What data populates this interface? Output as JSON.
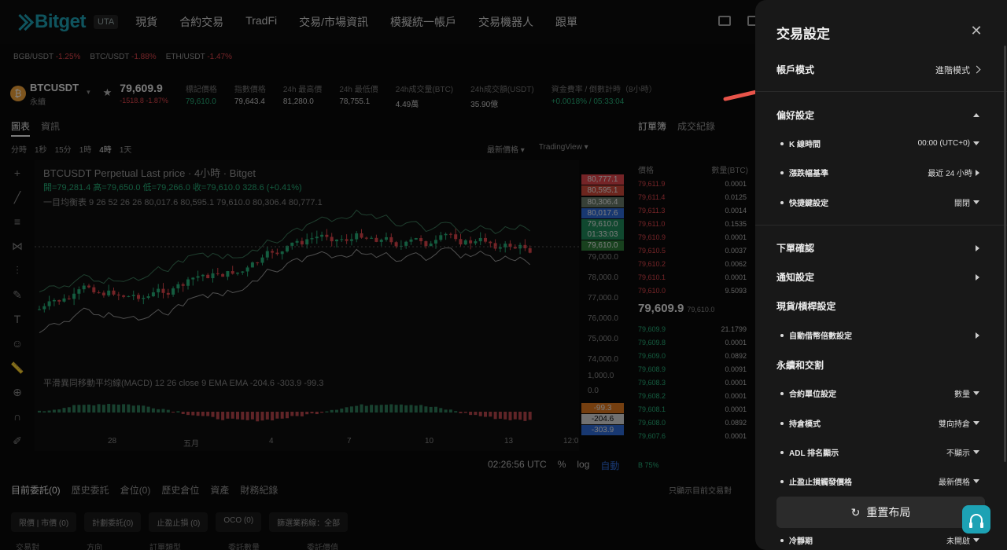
{
  "nav": {
    "brand": "Bitget",
    "brand_badge": "UTA",
    "items": [
      "現貨",
      "合約交易",
      "TradFi",
      "交易/市場資訊",
      "模擬統一帳戶",
      "交易機器人",
      "跟單"
    ]
  },
  "tickers": [
    {
      "pair": "BGB/USDT",
      "change": "-1.25%"
    },
    {
      "pair": "BTC/USDT",
      "change": "-1.88%"
    },
    {
      "pair": "ETH/USDT",
      "change": "-1.47%"
    }
  ],
  "symbol": {
    "coin_glyph": "₿",
    "name": "BTCUSDT",
    "type": "永續",
    "last": "79,609.9",
    "change": "-1518.8 -1.87%",
    "stats": [
      {
        "k": "標記價格",
        "v": "79,610.0"
      },
      {
        "k": "指數價格",
        "v": "79,643.4"
      },
      {
        "k": "24h 最高價",
        "v": "81,280.0"
      },
      {
        "k": "24h 最低價",
        "v": "78,755.1"
      },
      {
        "k": "24h成交量(BTC)",
        "v": "4.49萬"
      },
      {
        "k": "24h成交額(USDT)",
        "v": "35.90億"
      },
      {
        "k": "資金費率 / 倒數計時（8小時）",
        "v": "+0.0018% / 05:33:04"
      }
    ]
  },
  "chart": {
    "tabs": [
      "圖表",
      "資訊"
    ],
    "intervals": [
      "分時",
      "1秒",
      "15分",
      "1時",
      "4時",
      "1天"
    ],
    "active_interval": "4時",
    "right_controls": [
      "最新價格",
      "TradingView"
    ],
    "title": "BTCUSDT Perpetual Last price · 4小時 · Bitget",
    "ohlc": "開=79,281.4 高=79,650.0 低=79,266.0 收=79,610.0 328.6 (+0.41%)",
    "ichimoku": "一目均衡表 9 26 52 26 26  80,017.6  80,595.1  79,610.0  80,306.4  80,777.1",
    "macd": "平滑異同移動平均線(MACD) 12 26 close 9 EMA EMA  -204.6  -303.9  -99.3",
    "price_tags": [
      {
        "v": "80,777.1",
        "c": "#e0454c"
      },
      {
        "v": "80,595.1",
        "c": "#d04a3a"
      },
      {
        "v": "80,306.4",
        "c": "#6a7b6a"
      },
      {
        "v": "80,017.6",
        "c": "#2f6bd8"
      },
      {
        "v": "79,610.0",
        "c": "#1f8a5a"
      },
      {
        "v": "01:33:03",
        "c": "#1f8a5a"
      },
      {
        "v": "79,610.0",
        "c": "#2e7d3a"
      }
    ],
    "price_axis": [
      "79,000.0",
      "78,000.0",
      "77,000.0",
      "76,000.0",
      "75,000.0",
      "74,000.0",
      "1,000.0",
      "0.0"
    ],
    "macd_tags": [
      {
        "v": "-99.3",
        "c": "#e07a1f"
      },
      {
        "v": "-204.6",
        "c": "#d9d9d9"
      },
      {
        "v": "-303.9",
        "c": "#2f6bd8"
      }
    ],
    "time_axis": [
      "28",
      "五月",
      "4",
      "7",
      "10",
      "13",
      "12:0"
    ],
    "footer_time": "02:26:56 UTC",
    "footer_opts": [
      "%",
      "log",
      "自動"
    ]
  },
  "orderbook": {
    "tabs": [
      "訂單簿",
      "成交紀錄"
    ],
    "head": [
      "價格",
      "數量(BTC)"
    ],
    "asks": [
      [
        "79,611.9",
        "0.0001"
      ],
      [
        "79,611.4",
        "0.0125"
      ],
      [
        "79,611.3",
        "0.0014"
      ],
      [
        "79,611.0",
        "0.1535"
      ],
      [
        "79,610.9",
        "0.0001"
      ],
      [
        "79,610.5",
        "0.0037"
      ],
      [
        "79,610.2",
        "0.0062"
      ],
      [
        "79,610.1",
        "0.0001"
      ],
      [
        "79,610.0",
        "9.5093"
      ]
    ],
    "mid": "79,609.9",
    "mid_sub": "79,610.0",
    "bids": [
      [
        "79,609.9",
        "21.1799"
      ],
      [
        "79,609.8",
        "0.0001"
      ],
      [
        "79,609.0",
        "0.0892"
      ],
      [
        "79,608.9",
        "0.0091"
      ],
      [
        "79,608.3",
        "0.0001"
      ],
      [
        "79,608.2",
        "0.0001"
      ],
      [
        "79,608.1",
        "0.0001"
      ],
      [
        "79,608.0",
        "0.0892"
      ],
      [
        "79,607.6",
        "0.0001"
      ]
    ],
    "ratio": "B 75%"
  },
  "bottom": {
    "tabs": [
      "目前委託(0)",
      "歷史委託",
      "倉位(0)",
      "歷史倉位",
      "資產",
      "財務紀錄"
    ],
    "only_show": "只顯示目前交易對",
    "sub_tabs": [
      "限價 | 市價 (0)",
      "計劃委託(0)",
      "止盈止損 (0)",
      "OCO (0)",
      "篩選業務線：全部"
    ],
    "cols": [
      "交易對",
      "方向",
      "訂單類型",
      "委託數量",
      "委託價值"
    ]
  },
  "drawer": {
    "title": "交易設定",
    "account_mode": {
      "label": "帳戶模式",
      "value": "進階模式"
    },
    "preferences": {
      "label": "偏好設定",
      "items": [
        {
          "label": "K 線時間",
          "value": "00:00 (UTC+0)",
          "ctl": "down"
        },
        {
          "label": "漲跌幅基準",
          "value": "最近 24 小時",
          "ctl": "right"
        },
        {
          "label": "快捷鍵設定",
          "value": "關閉",
          "ctl": "down"
        }
      ]
    },
    "order_confirm": "下單確認",
    "notify": "通知設定",
    "spot_margin": "現貨/槓桿設定",
    "auto_borrow": "自動借幣倍數設定",
    "perp_delivery": "永續和交割",
    "perp_items": [
      {
        "label": "合約單位設定",
        "value": "數量"
      },
      {
        "label": "持倉模式",
        "value": "雙向持倉"
      },
      {
        "label": "ADL 排名顯示",
        "value": "不顯示"
      },
      {
        "label": "止盈止損觸發價格",
        "value": "最新價格"
      }
    ],
    "cooldown": {
      "label": "冷靜期",
      "value": "未開啟"
    },
    "reset_label": "重置布局"
  },
  "colors": {
    "brand": "#1da2b4",
    "up": "#27b07a",
    "down": "#e0454c",
    "annotation_arrow": "#e8544a"
  }
}
